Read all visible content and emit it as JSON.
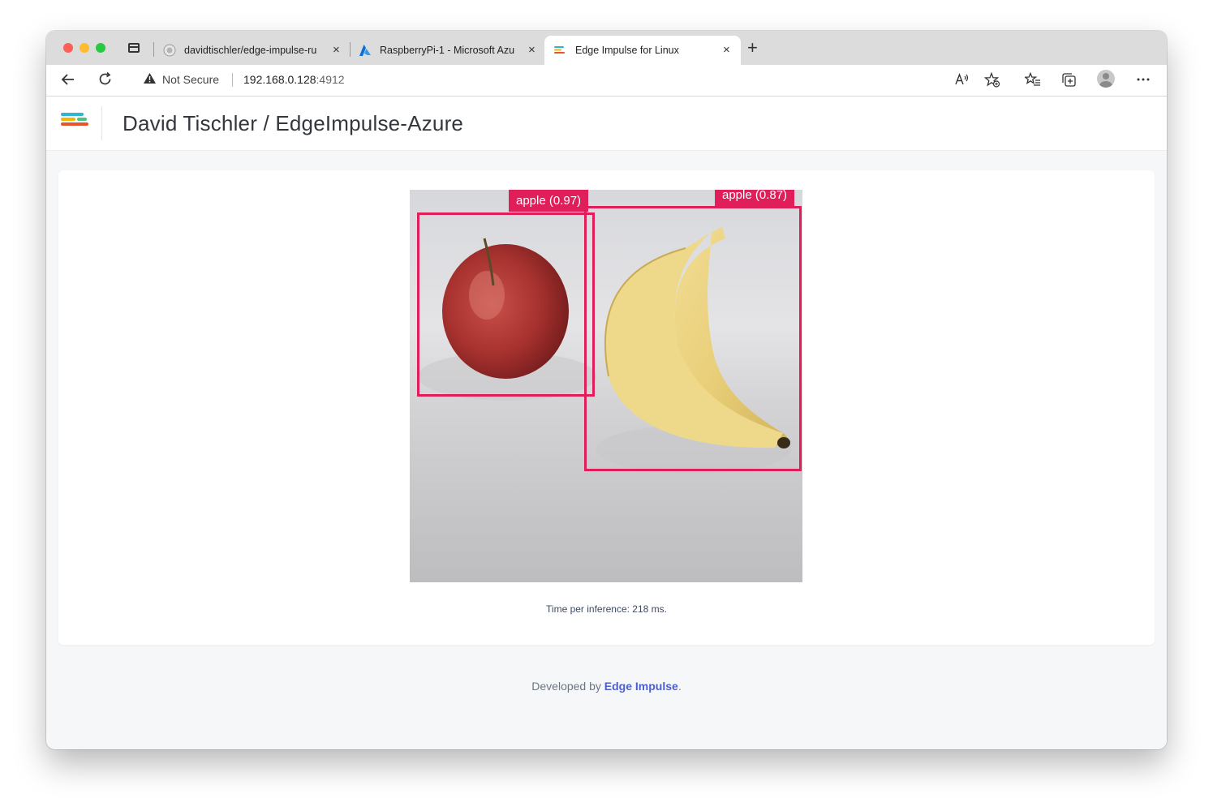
{
  "browser": {
    "tabs": [
      {
        "label": "davidtischler/edge-impulse-ru",
        "close": "×",
        "icon": "github-icon"
      },
      {
        "label": "RaspberryPi-1 - Microsoft Azu",
        "close": "×",
        "icon": "azure-icon"
      },
      {
        "label": "Edge Impulse for Linux",
        "close": "×",
        "icon": "edge-impulse-icon",
        "active": true
      }
    ],
    "new_tab": "+",
    "security_label": "Not Secure",
    "url_host": "192.168.0.128",
    "url_port": ":4912"
  },
  "header": {
    "title": "David Tischler / EdgeImpulse-Azure"
  },
  "detections": [
    {
      "label": "apple (0.97)"
    },
    {
      "label": "apple (0.87)"
    }
  ],
  "inference": {
    "time_text": "Time per inference: 218 ms."
  },
  "footer": {
    "prefix": "Developed by ",
    "link": "Edge Impulse",
    "suffix": "."
  },
  "colors": {
    "bbox": "#e01e5a",
    "link": "#4b5fd0",
    "logo": [
      "#2fb5d2",
      "#f5b400",
      "#4ec37a",
      "#e8532b"
    ]
  }
}
